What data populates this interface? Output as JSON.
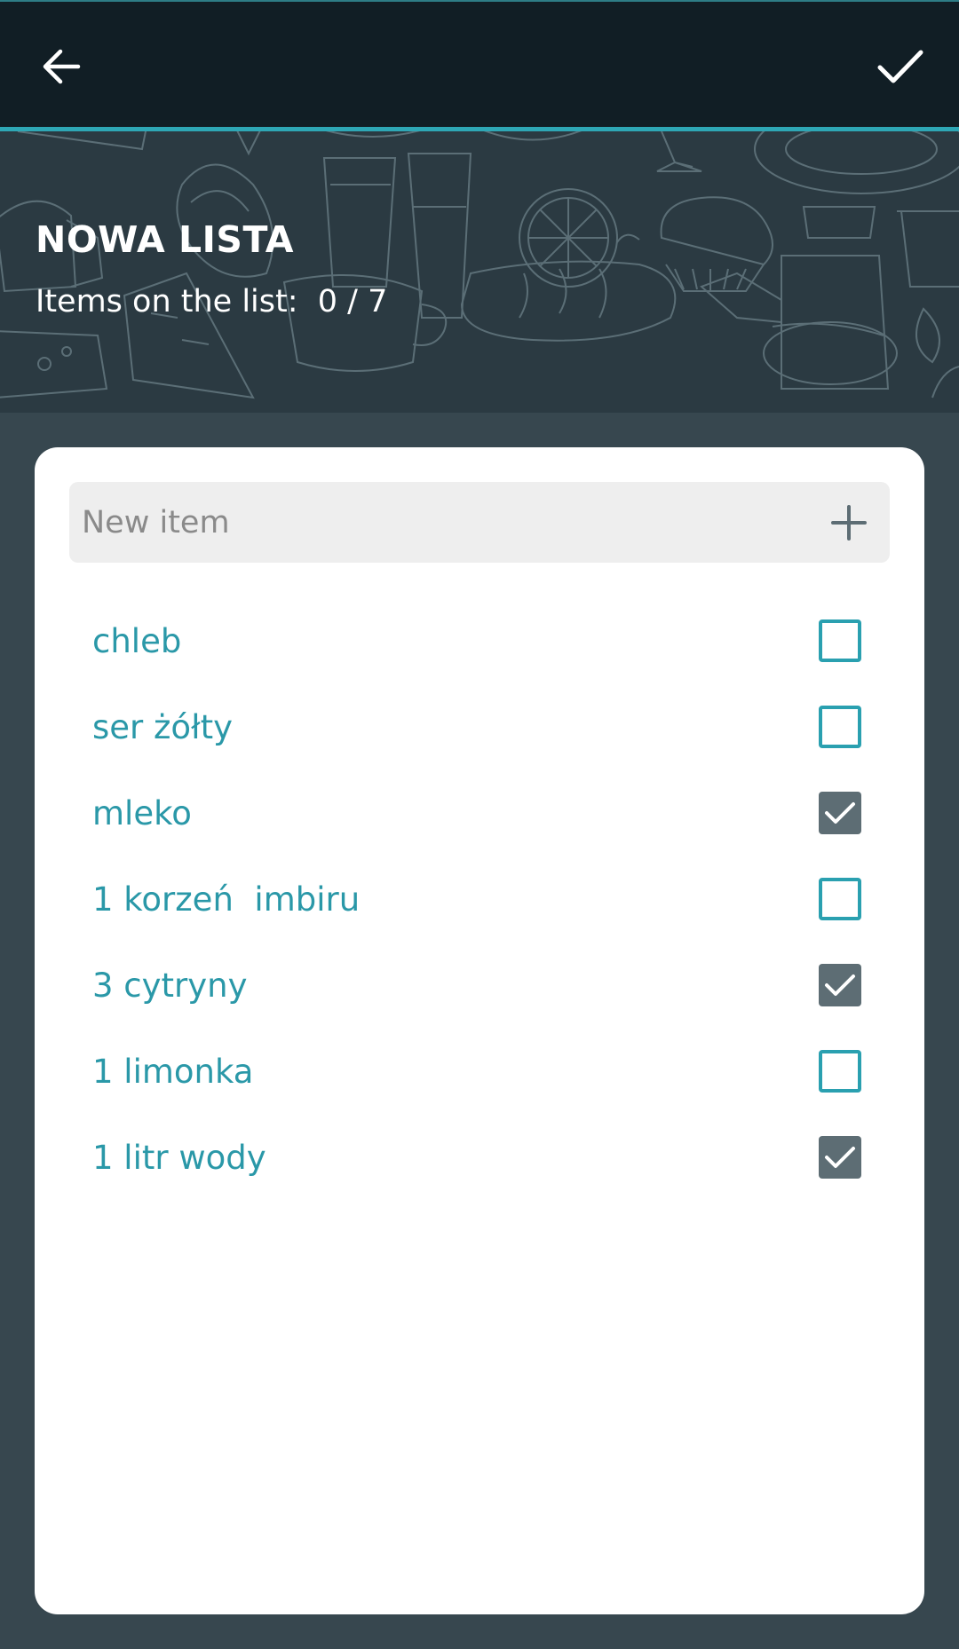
{
  "toolbar": {
    "back_icon": "arrow-left-icon",
    "confirm_icon": "checkmark-icon"
  },
  "header": {
    "title": "NOWA LISTA",
    "count_text": "Items on the list:  0 / 7"
  },
  "new_item": {
    "placeholder": "New item",
    "value": "",
    "add_icon": "plus-icon"
  },
  "items": [
    {
      "label": "chleb",
      "checked": false
    },
    {
      "label": "ser żółty",
      "checked": false
    },
    {
      "label": "mleko",
      "checked": true
    },
    {
      "label": "1 korzeń  imbiru",
      "checked": false
    },
    {
      "label": "3 cytryny",
      "checked": true
    },
    {
      "label": "1 limonka",
      "checked": false
    },
    {
      "label": "1 litr wody",
      "checked": true
    }
  ],
  "colors": {
    "accent": "#2ea7b5",
    "toolbar_bg": "#111e25",
    "header_bg": "#2b3a42",
    "page_bg": "#37474f",
    "item_text": "#2a98a8",
    "checked_fill": "#5d6d74"
  }
}
